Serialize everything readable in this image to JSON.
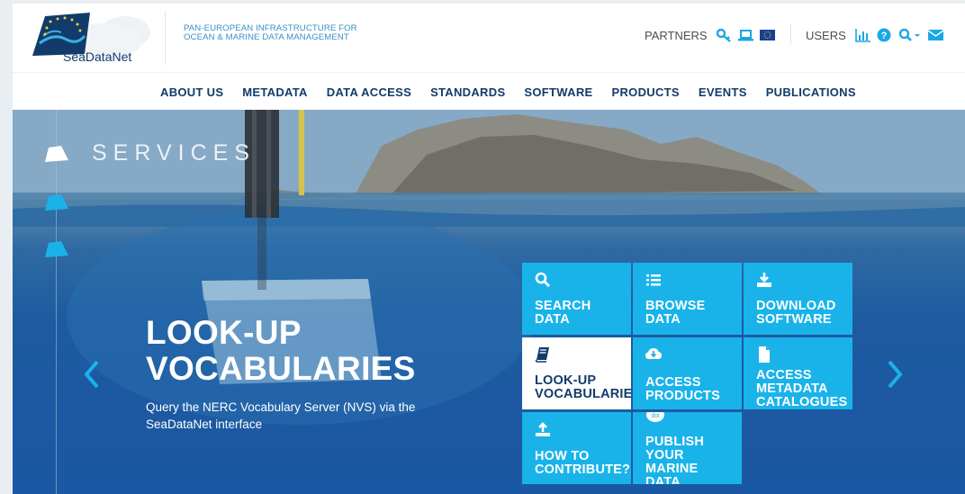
{
  "header": {
    "logo_text": "SeaDataNet",
    "tagline_line1": "PAN-EUROPEAN INFRASTRUCTURE FOR",
    "tagline_line2": "OCEAN & MARINE DATA MANAGEMENT",
    "partners_label": "PARTNERS",
    "partners_icons": [
      "key-icon",
      "laptop-icon",
      "eu-flag-icon"
    ],
    "users_label": "USERS",
    "users_icons": [
      "bar-chart-icon",
      "help-icon",
      "search-icon",
      "envelope-icon"
    ]
  },
  "nav": {
    "items": [
      "ABOUT US",
      "METADATA",
      "DATA ACCESS",
      "STANDARDS",
      "SOFTWARE",
      "PRODUCTS",
      "EVENTS",
      "PUBLICATIONS"
    ]
  },
  "hero": {
    "section_title": "SERVICES",
    "slide_title_line1": "LOOK-UP",
    "slide_title_line2": "VOCABULARIES",
    "slide_desc": "Query the NERC Vocabulary Server (NVS) via the SeaDataNet interface",
    "prev_icon": "chevron-left-icon",
    "next_icon": "chevron-right-icon"
  },
  "tiles": [
    {
      "line1": "SEARCH",
      "line2": "DATA",
      "line3": "",
      "line4": "",
      "icon": "search-icon",
      "active": false
    },
    {
      "line1": "BROWSE",
      "line2": "DATA",
      "line3": "",
      "line4": "",
      "icon": "list-icon",
      "active": false
    },
    {
      "line1": "DOWNLOAD",
      "line2": "SOFTWARE",
      "line3": "",
      "line4": "",
      "icon": "download-icon",
      "active": false
    },
    {
      "line1": "LOOK-UP",
      "line2": "VOCABULARIES",
      "line3": "",
      "line4": "",
      "icon": "book-icon",
      "active": true
    },
    {
      "line1": "ACCESS",
      "line2": "PRODUCTS",
      "line3": "",
      "line4": "",
      "icon": "cloud-download-icon",
      "active": false
    },
    {
      "line1": "ACCESS",
      "line2": "METADATA",
      "line3": "CATALOGUES",
      "line4": "",
      "icon": "file-icon",
      "active": false
    },
    {
      "line1": "HOW TO",
      "line2": "CONTRIBUTE?",
      "line3": "",
      "line4": "",
      "icon": "upload-icon",
      "active": false
    },
    {
      "line1": "PUBLISH",
      "line2": "YOUR",
      "line3": "MARINE",
      "line4": "DATA",
      "icon": "doi-icon",
      "active": false
    }
  ],
  "colors": {
    "brand_blue": "#123b6b",
    "tile_cyan": "#19b3ea",
    "icon_cyan": "#1ba7e3",
    "tagline_blue": "#3a8fc7"
  }
}
